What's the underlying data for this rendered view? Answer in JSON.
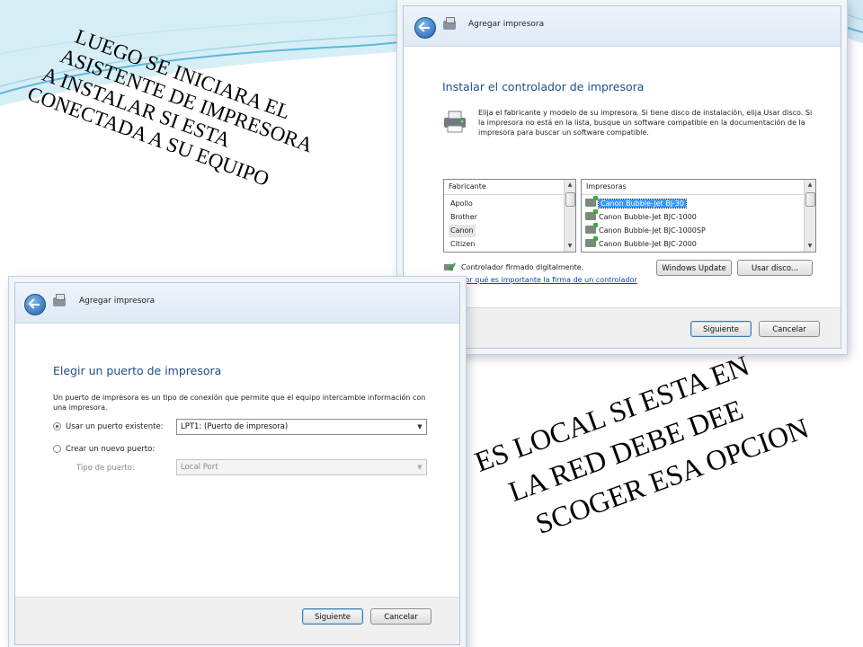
{
  "slide": {
    "note_top": [
      "LUEGO SE INICIARA EL",
      "ASISTENTE DE IMPRESORA",
      "A INSTALAR SI  ESTA",
      "CONECTADA A SU EQUIPO"
    ],
    "note_bottom": [
      "ES LOCAL   SI ESTA EN",
      "LA RED DEBE DEE",
      "SCOGER  ESA OPCION"
    ]
  },
  "driver_window": {
    "window_title": "Agregar impresora",
    "heading": "Instalar el controlador de impresora",
    "description": "Elija el fabricante y modelo de su impresora. Si tiene disco de instalación, elija Usar disco. Si la impresora no está en la lista, busque un software compatible en la documentación de la impresora para buscar un software compatible.",
    "manufacturer_header": "Fabricante",
    "manufacturers": [
      "Apollo",
      "Brother",
      "Canon",
      "Citizen"
    ],
    "selected_manufacturer": "Canon",
    "printers_header": "Impresoras",
    "printers": [
      "Canon Bubble-Jet BJ-30",
      "Canon Bubble-Jet BJC-1000",
      "Canon Bubble-Jet BJC-1000SP",
      "Canon Bubble-Jet BJC-2000"
    ],
    "selected_printer": "Canon Bubble-Jet BJ-30",
    "signed_driver": "Controlador firmado digitalmente.",
    "signing_link": "Por qué es importante la firma de un controlador",
    "windows_update": "Windows Update",
    "have_disk": "Usar disco...",
    "next": "Siguiente",
    "cancel": "Cancelar"
  },
  "port_window": {
    "window_title": "Agregar impresora",
    "heading": "Elegir un puerto de impresora",
    "description": "Un puerto de impresora es un tipo de conexión que permite que el equipo intercambie información con una impresora.",
    "use_existing_label": "Usar un puerto existente:",
    "existing_port_value": "LPT1: (Puerto de impresora)",
    "create_new_label": "Crear un nuevo puerto:",
    "port_type_label": "Tipo de puerto:",
    "port_type_value": "Local Port",
    "next": "Siguiente",
    "cancel": "Cancelar"
  },
  "colors": {
    "heading_blue": "#1e4e8c",
    "selection_blue": "#3399ff",
    "link_blue": "#0645ad",
    "accent_swoosh": "#5bb8d8"
  }
}
